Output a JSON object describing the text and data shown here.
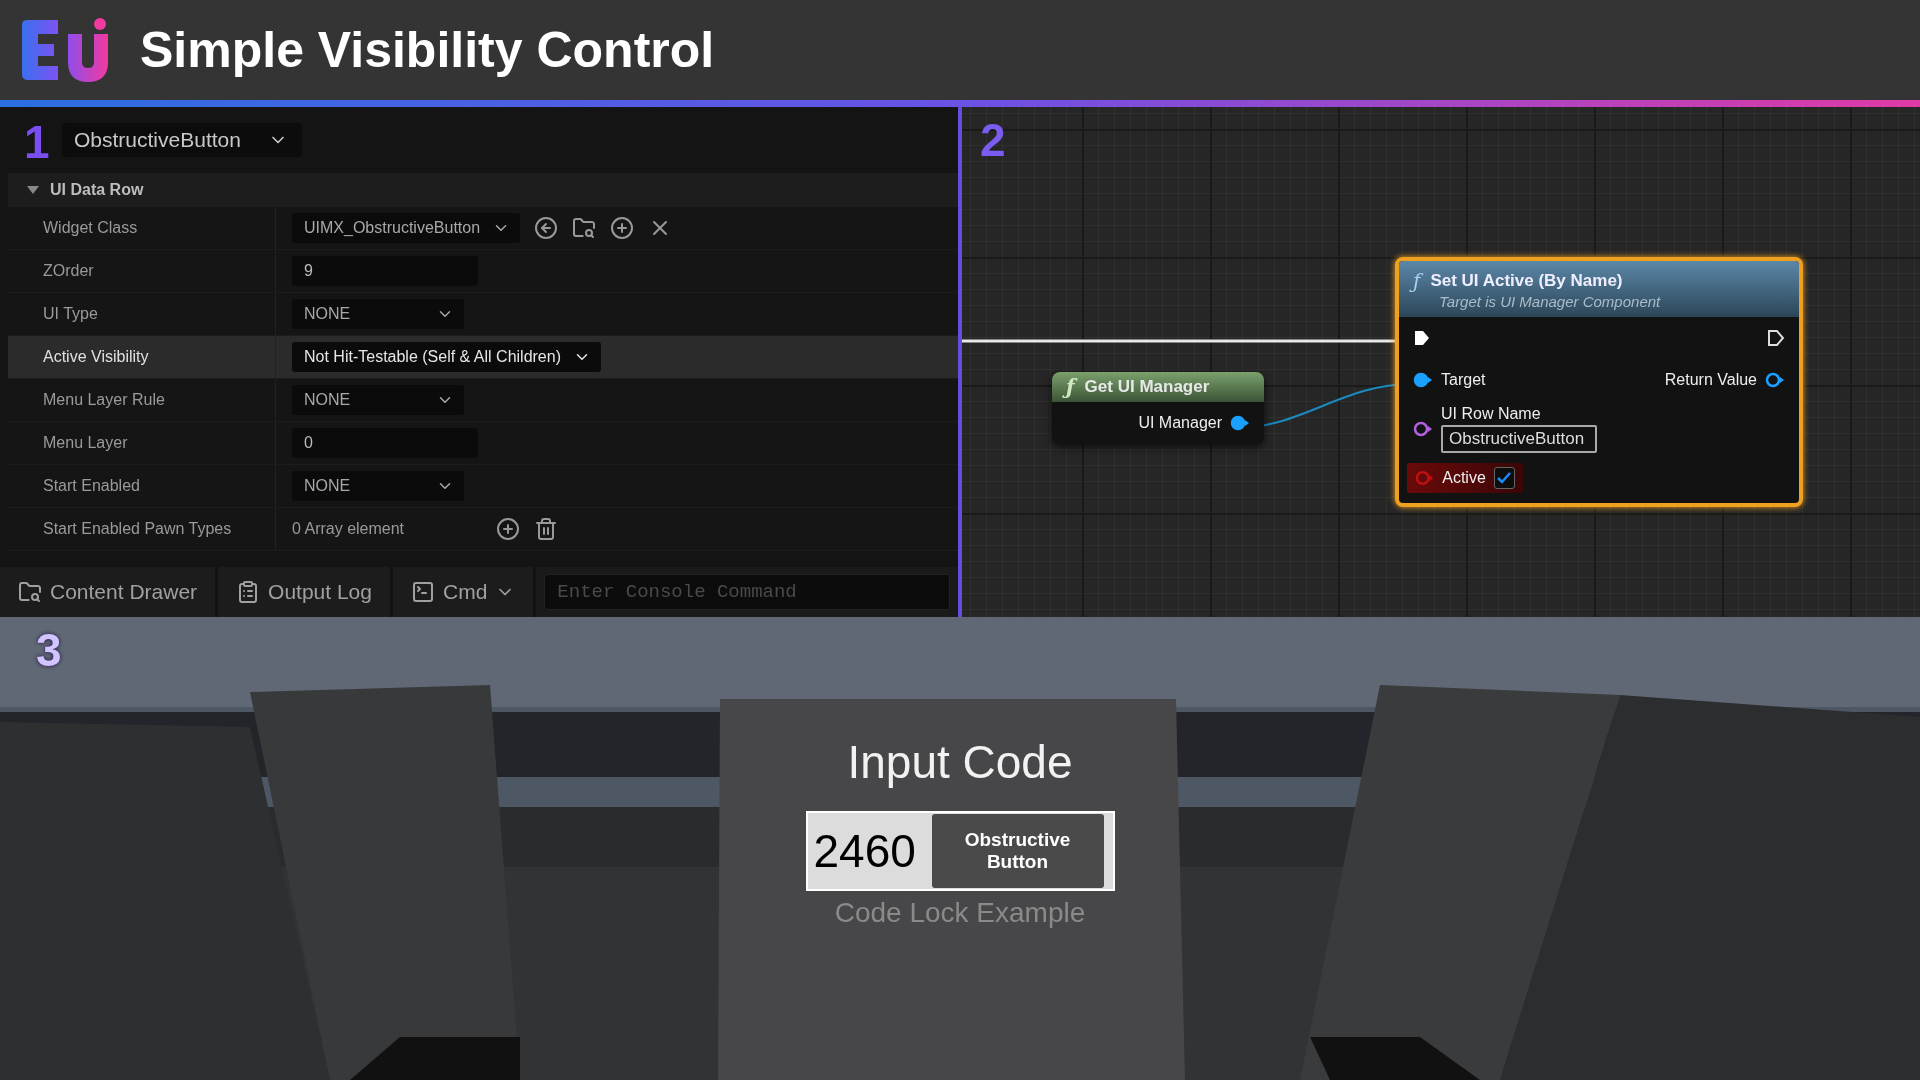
{
  "header": {
    "title": "Simple Visibility Control"
  },
  "details": {
    "number": "1",
    "selector": "ObstructiveButton",
    "category": {
      "label": "UI Data Row",
      "expanded": true
    },
    "rows": [
      {
        "kind": "class",
        "label": "Widget Class",
        "value": "UIMX_ObstructiveButton",
        "selected": false
      },
      {
        "kind": "number",
        "label": "ZOrder",
        "value": "9",
        "selected": false
      },
      {
        "kind": "dropdown",
        "label": "UI Type",
        "value": "NONE",
        "selected": false
      },
      {
        "kind": "dropdown",
        "label": "Active Visibility",
        "value": "Not Hit-Testable (Self & All Children)",
        "selected": true
      },
      {
        "kind": "dropdown",
        "label": "Menu Layer Rule",
        "value": "NONE",
        "selected": false
      },
      {
        "kind": "number",
        "label": "Menu Layer",
        "value": "0",
        "selected": false
      },
      {
        "kind": "dropdown",
        "label": "Start Enabled",
        "value": "NONE",
        "selected": false
      },
      {
        "kind": "array",
        "label": "Start Enabled Pawn Types",
        "value": "0 Array element",
        "selected": false
      }
    ]
  },
  "toolbar": {
    "items": [
      {
        "kind": "drawer",
        "label": "Content Drawer"
      },
      {
        "kind": "log",
        "label": "Output Log"
      },
      {
        "kind": "cmd",
        "label": "Cmd"
      }
    ],
    "console_placeholder": "Enter Console Command"
  },
  "graph": {
    "number": "2",
    "get_node": {
      "icon": "ƒ",
      "title": "Get UI Manager",
      "pin": "UI Manager"
    },
    "set_node": {
      "icon": "ƒ",
      "title": "Set UI Active (By Name)",
      "subtitle": "Target is UI Manager Component",
      "target": "Target",
      "return_value": "Return Value",
      "row_name_label": "UI Row Name",
      "row_name_value": "ObstructiveButton",
      "active_label": "Active",
      "active_checked": true
    }
  },
  "scene": {
    "number": "3",
    "title": "Input Code",
    "code": "2460",
    "button": "Obstructive Button",
    "caption": "Code Lock Example"
  }
}
